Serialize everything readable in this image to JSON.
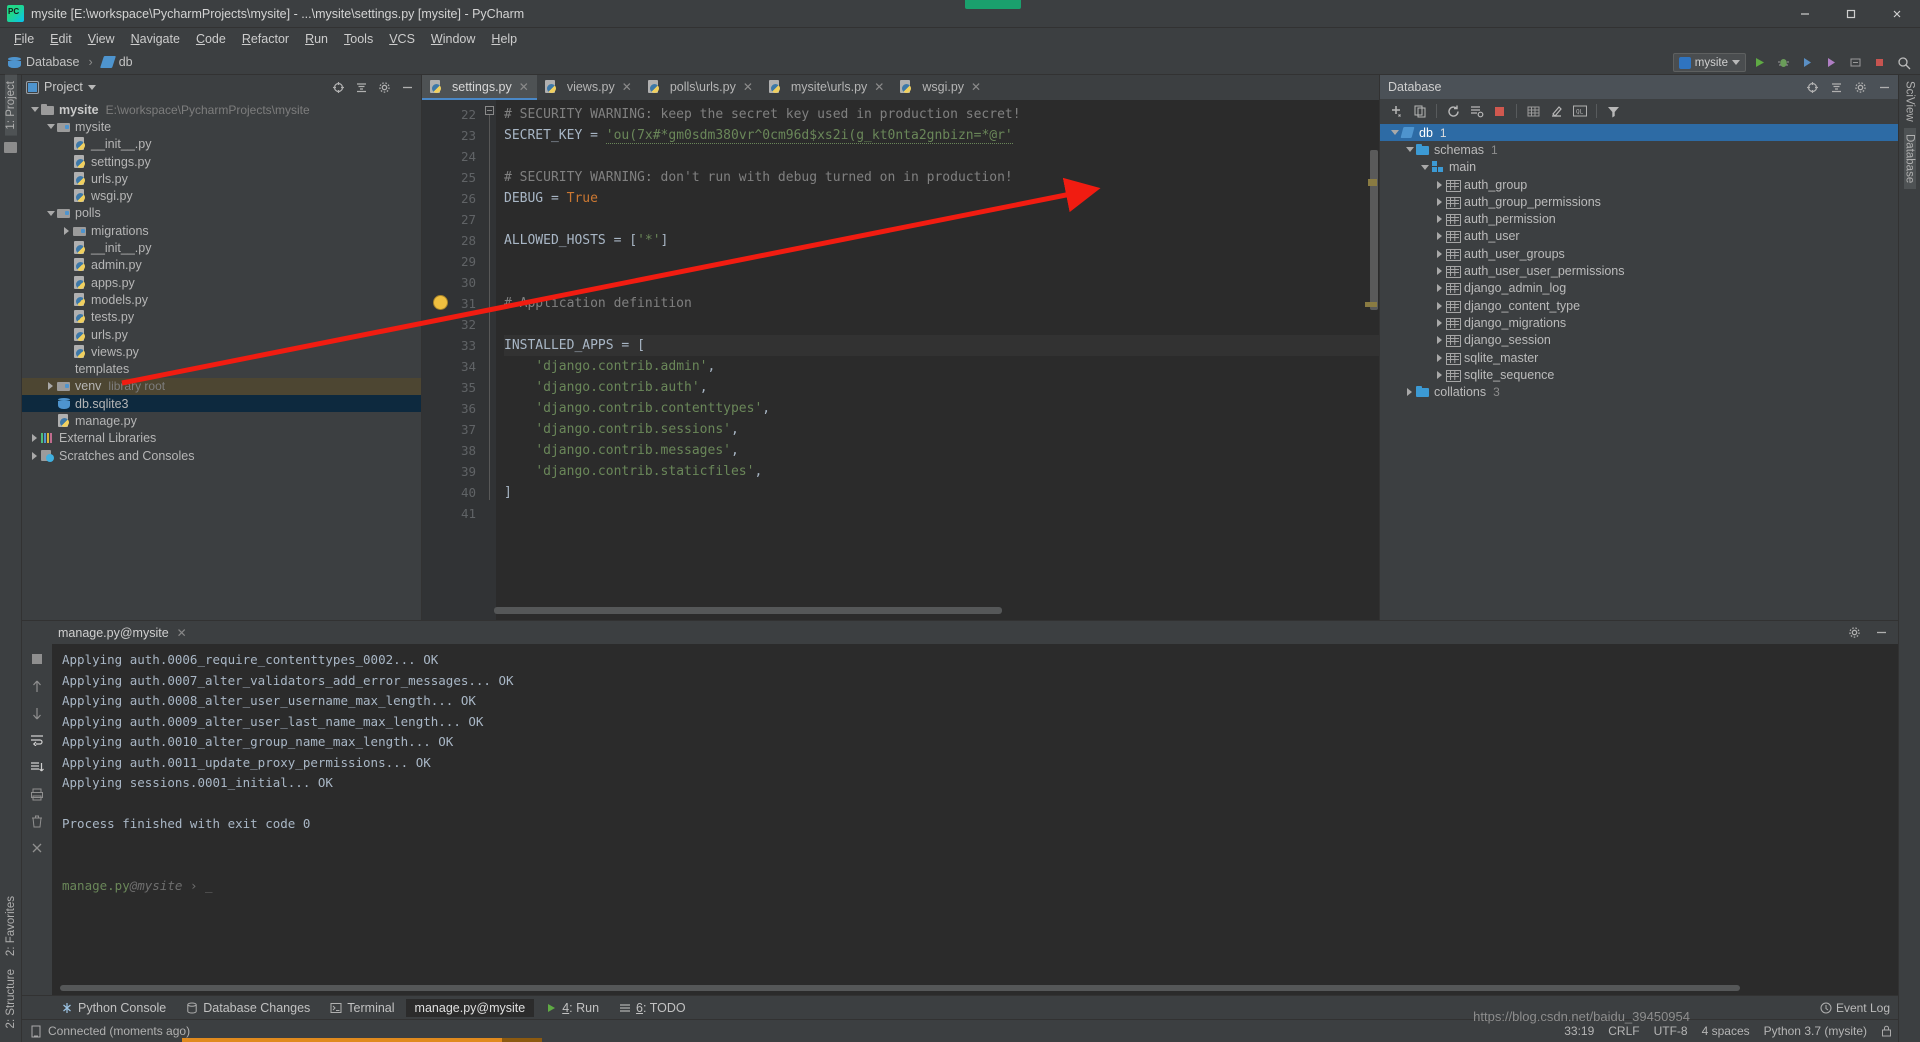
{
  "window": {
    "title": "mysite [E:\\workspace\\PycharmProjects\\mysite] - ...\\mysite\\settings.py [mysite] - PyCharm",
    "minimize": "─",
    "maximize": "☐",
    "close": "✕"
  },
  "menubar": {
    "items": [
      "File",
      "Edit",
      "View",
      "Navigate",
      "Code",
      "Refactor",
      "Run",
      "Tools",
      "VCS",
      "Window",
      "Help"
    ]
  },
  "breadcrumb": {
    "database": "Database",
    "separator": "›",
    "db": "db"
  },
  "toolbar": {
    "run_config": "mysite",
    "icons": [
      "run-icon",
      "debug-icon",
      "coverage-icon",
      "profile-icon",
      "attach-icon",
      "stop-icon",
      "search-everywhere-icon"
    ]
  },
  "left_rail": {
    "project": "1: Project",
    "structure": "2: Structure",
    "favorites": "2: Favorites"
  },
  "right_rail": {
    "sciview": "SciView",
    "database": "Database"
  },
  "project_panel": {
    "title": "Project",
    "tree": [
      {
        "depth": 0,
        "arrow": "down",
        "icon": "folder",
        "label": "mysite",
        "bold": true,
        "path": "E:\\workspace\\PycharmProjects\\mysite"
      },
      {
        "depth": 1,
        "arrow": "down",
        "icon": "module",
        "label": "mysite"
      },
      {
        "depth": 2,
        "arrow": "none",
        "icon": "py",
        "label": "__init__.py"
      },
      {
        "depth": 2,
        "arrow": "none",
        "icon": "py",
        "label": "settings.py"
      },
      {
        "depth": 2,
        "arrow": "none",
        "icon": "py",
        "label": "urls.py"
      },
      {
        "depth": 2,
        "arrow": "none",
        "icon": "py",
        "label": "wsgi.py"
      },
      {
        "depth": 1,
        "arrow": "down",
        "icon": "module",
        "label": "polls"
      },
      {
        "depth": 2,
        "arrow": "right",
        "icon": "module",
        "label": "migrations"
      },
      {
        "depth": 2,
        "arrow": "none",
        "icon": "py",
        "label": "__init__.py"
      },
      {
        "depth": 2,
        "arrow": "none",
        "icon": "py",
        "label": "admin.py"
      },
      {
        "depth": 2,
        "arrow": "none",
        "icon": "py",
        "label": "apps.py"
      },
      {
        "depth": 2,
        "arrow": "none",
        "icon": "py",
        "label": "models.py"
      },
      {
        "depth": 2,
        "arrow": "none",
        "icon": "py",
        "label": "tests.py"
      },
      {
        "depth": 2,
        "arrow": "none",
        "icon": "py",
        "label": "urls.py"
      },
      {
        "depth": 2,
        "arrow": "none",
        "icon": "py",
        "label": "views.py"
      },
      {
        "depth": 1,
        "arrow": "none",
        "icon": "folder-purple",
        "label": "templates"
      },
      {
        "depth": 1,
        "arrow": "right",
        "icon": "module",
        "label": "venv",
        "path": "library root",
        "state": "venv"
      },
      {
        "depth": 1,
        "arrow": "none",
        "icon": "sqlite",
        "label": "db.sqlite3",
        "state": "selected"
      },
      {
        "depth": 1,
        "arrow": "none",
        "icon": "py",
        "label": "manage.py"
      },
      {
        "depth": 0,
        "arrow": "right",
        "icon": "lib",
        "label": "External Libraries"
      },
      {
        "depth": 0,
        "arrow": "right",
        "icon": "scratch",
        "label": "Scratches and Consoles"
      }
    ]
  },
  "editor": {
    "tabs": [
      {
        "label": "settings.py",
        "active": true
      },
      {
        "label": "views.py",
        "active": false
      },
      {
        "label": "polls\\urls.py",
        "active": false
      },
      {
        "label": "mysite\\urls.py",
        "active": false
      },
      {
        "label": "wsgi.py",
        "active": false
      }
    ],
    "first_line_number": 22,
    "lines": [
      {
        "n": 22,
        "segments": [
          {
            "t": "# SECURITY WARNING: keep the secret key used in production secret!",
            "c": "comment"
          }
        ]
      },
      {
        "n": 23,
        "segments": [
          {
            "t": "SECRET_KEY",
            "c": "ident"
          },
          {
            "t": " = ",
            "c": "ident"
          },
          {
            "t": "'ou(7x#*gm0sdm380vr^0cm96d$xs2i(g_kt0nta2gnbizn=*@r'",
            "c": "str"
          }
        ]
      },
      {
        "n": 24,
        "segments": []
      },
      {
        "n": 25,
        "segments": [
          {
            "t": "# SECURITY WARNING: don't run with debug turned on in production!",
            "c": "comment"
          }
        ]
      },
      {
        "n": 26,
        "segments": [
          {
            "t": "DEBUG",
            "c": "ident"
          },
          {
            "t": " = ",
            "c": "ident"
          },
          {
            "t": "True",
            "c": "kw"
          }
        ]
      },
      {
        "n": 27,
        "segments": []
      },
      {
        "n": 28,
        "segments": [
          {
            "t": "ALLOWED_HOSTS",
            "c": "ident"
          },
          {
            "t": " = [",
            "c": "ident"
          },
          {
            "t": "'*'",
            "c": "str"
          },
          {
            "t": "]",
            "c": "ident"
          }
        ]
      },
      {
        "n": 29,
        "segments": []
      },
      {
        "n": 30,
        "segments": []
      },
      {
        "n": 31,
        "segments": [
          {
            "t": "# Application definition",
            "c": "comment"
          }
        ]
      },
      {
        "n": 32,
        "segments": []
      },
      {
        "n": 33,
        "segments": [
          {
            "t": "INSTALLED_APPS",
            "c": "ident"
          },
          {
            "t": " = ",
            "c": "ident"
          },
          {
            "t": "[",
            "c": "brk"
          }
        ],
        "highlight": true
      },
      {
        "n": 34,
        "segments": [
          {
            "t": "    ",
            "c": "ident"
          },
          {
            "t": "'django.contrib.admin'",
            "c": "str"
          },
          {
            "t": ",",
            "c": "ident"
          }
        ]
      },
      {
        "n": 35,
        "segments": [
          {
            "t": "    ",
            "c": "ident"
          },
          {
            "t": "'django.contrib.auth'",
            "c": "str"
          },
          {
            "t": ",",
            "c": "ident"
          }
        ]
      },
      {
        "n": 36,
        "segments": [
          {
            "t": "    ",
            "c": "ident"
          },
          {
            "t": "'django.contrib.contenttypes'",
            "c": "str"
          },
          {
            "t": ",",
            "c": "ident"
          }
        ]
      },
      {
        "n": 37,
        "segments": [
          {
            "t": "    ",
            "c": "ident"
          },
          {
            "t": "'django.contrib.sessions'",
            "c": "str"
          },
          {
            "t": ",",
            "c": "ident"
          }
        ]
      },
      {
        "n": 38,
        "segments": [
          {
            "t": "    ",
            "c": "ident"
          },
          {
            "t": "'django.contrib.messages'",
            "c": "str"
          },
          {
            "t": ",",
            "c": "ident"
          }
        ]
      },
      {
        "n": 39,
        "segments": [
          {
            "t": "    ",
            "c": "ident"
          },
          {
            "t": "'django.contrib.staticfiles'",
            "c": "str"
          },
          {
            "t": ",",
            "c": "ident"
          }
        ]
      },
      {
        "n": 40,
        "segments": [
          {
            "t": "]",
            "c": "brk"
          }
        ]
      },
      {
        "n": 41,
        "segments": []
      }
    ]
  },
  "database_panel": {
    "title": "Database",
    "tree": [
      {
        "depth": 0,
        "arrow": "down",
        "icon": "sqlitefile",
        "label": "db",
        "count": "1",
        "state": "selected"
      },
      {
        "depth": 1,
        "arrow": "down",
        "icon": "folder-db",
        "label": "schemas",
        "count": "1"
      },
      {
        "depth": 2,
        "arrow": "down",
        "icon": "schema",
        "label": "main"
      },
      {
        "depth": 3,
        "arrow": "right",
        "icon": "tbl",
        "label": "auth_group"
      },
      {
        "depth": 3,
        "arrow": "right",
        "icon": "tbl",
        "label": "auth_group_permissions"
      },
      {
        "depth": 3,
        "arrow": "right",
        "icon": "tbl",
        "label": "auth_permission"
      },
      {
        "depth": 3,
        "arrow": "right",
        "icon": "tbl",
        "label": "auth_user"
      },
      {
        "depth": 3,
        "arrow": "right",
        "icon": "tbl",
        "label": "auth_user_groups"
      },
      {
        "depth": 3,
        "arrow": "right",
        "icon": "tbl",
        "label": "auth_user_user_permissions"
      },
      {
        "depth": 3,
        "arrow": "right",
        "icon": "tbl",
        "label": "django_admin_log"
      },
      {
        "depth": 3,
        "arrow": "right",
        "icon": "tbl",
        "label": "django_content_type"
      },
      {
        "depth": 3,
        "arrow": "right",
        "icon": "tbl",
        "label": "django_migrations"
      },
      {
        "depth": 3,
        "arrow": "right",
        "icon": "tbl",
        "label": "django_session"
      },
      {
        "depth": 3,
        "arrow": "right",
        "icon": "tbl",
        "label": "sqlite_master"
      },
      {
        "depth": 3,
        "arrow": "right",
        "icon": "tbl",
        "label": "sqlite_sequence"
      },
      {
        "depth": 1,
        "arrow": "right",
        "icon": "folder-db",
        "label": "collations",
        "count": "3"
      }
    ]
  },
  "console": {
    "tab_label": "manage.py@mysite",
    "close": "✕",
    "lines": [
      "Applying auth.0006_require_contenttypes_0002... OK",
      "Applying auth.0007_alter_validators_add_error_messages... OK",
      "Applying auth.0008_alter_user_username_max_length... OK",
      "Applying auth.0009_alter_user_last_name_max_length... OK",
      "Applying auth.0010_alter_group_name_max_length... OK",
      "Applying auth.0011_update_proxy_permissions... OK",
      "Applying sessions.0001_initial... OK",
      "",
      "Process finished with exit code 0"
    ],
    "prompt_file": "manage.py",
    "prompt_at": "@mysite",
    "prompt_arrow": "›",
    "prompt_cursor": "_"
  },
  "bottom_tabs": [
    {
      "label": "Python Console",
      "icon": "python-console-icon",
      "active": false
    },
    {
      "label": "Database Changes",
      "icon": "database-changes-icon",
      "active": false
    },
    {
      "label": "Terminal",
      "icon": "terminal-icon",
      "active": false
    },
    {
      "label": "manage.py@mysite",
      "icon": "none",
      "active": true
    },
    {
      "label": "4: Run",
      "icon": "run-icon",
      "active": false
    },
    {
      "label": "6: TODO",
      "icon": "todo-icon",
      "active": false
    }
  ],
  "bottom_right": {
    "event_log": "Event Log"
  },
  "statusbar": {
    "connection": "Connected (moments ago)",
    "caret": "33:19",
    "line_sep": "CRLF",
    "encoding": "UTF-8",
    "indent": "4 spaces",
    "interpreter": "Python 3.7 (mysite)",
    "watermark": "https://blog.csdn.net/baidu_39450954"
  }
}
